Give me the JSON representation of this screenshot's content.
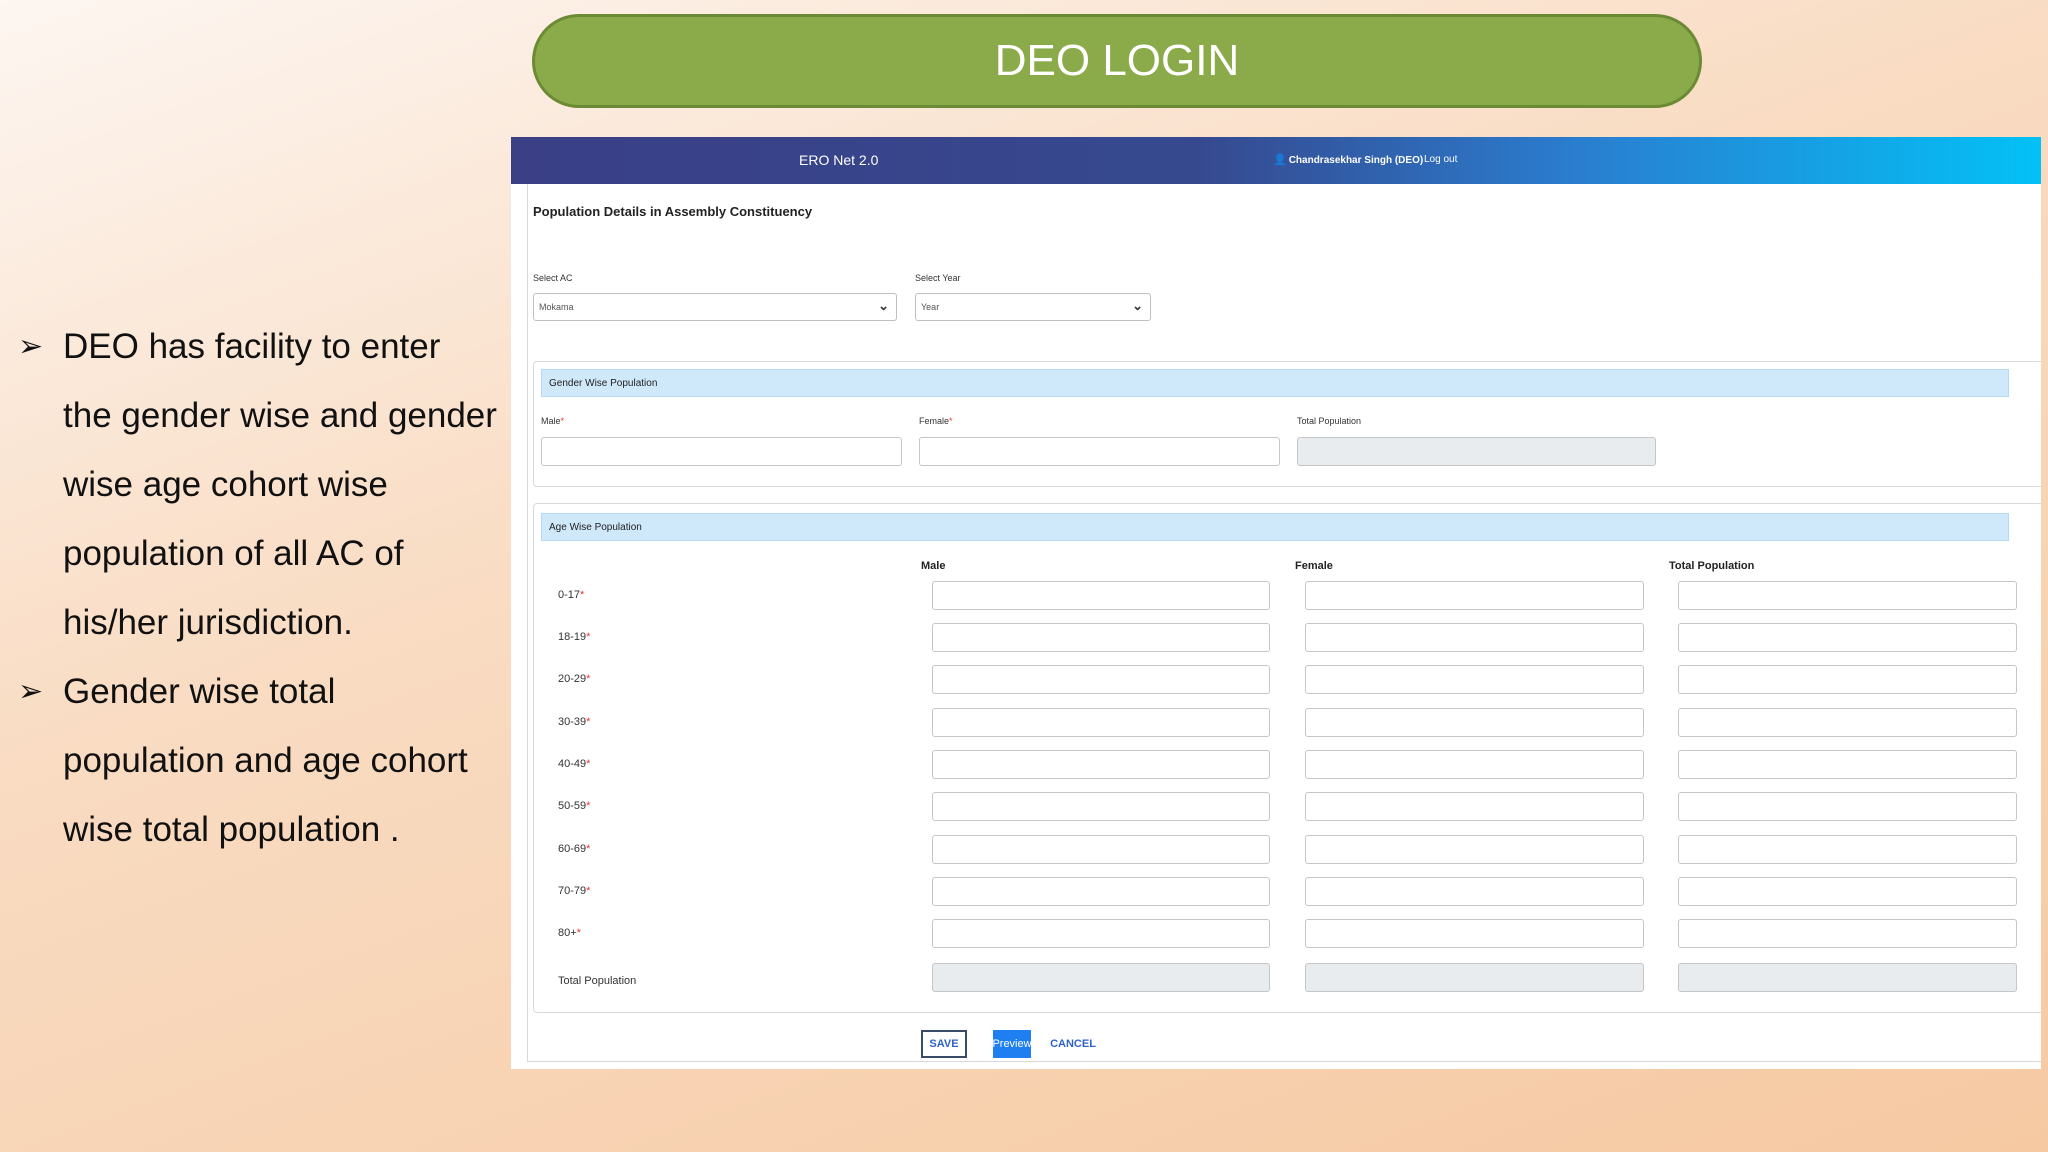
{
  "slide_title": "DEO LOGIN",
  "bullets": [
    {
      "text": "DEO has facility to enter the gender wise and gender wise age cohort wise population of all AC of his/her jurisdiction."
    },
    {
      "text": "Gender wise total population and age cohort wise total population ."
    }
  ],
  "app": {
    "name": "ERO Net 2.0",
    "user": "Chandrasekhar Singh (DEO)",
    "logout": "Log out"
  },
  "page_title": "Population Details in Assembly Constituency",
  "filters": {
    "ac_label": "Select AC",
    "ac_value": "Mokama",
    "year_label": "Select Year",
    "year_value": "Year"
  },
  "gender_section": {
    "title": "Gender Wise Population",
    "male_label": "Male",
    "female_label": "Female",
    "total_label": "Total Population"
  },
  "age_section": {
    "title": "Age Wise Population",
    "columns": [
      "Male",
      "Female",
      "Total Population"
    ],
    "rows": [
      "0-17",
      "18-19",
      "20-29",
      "30-39",
      "40-49",
      "50-59",
      "60-69",
      "70-79",
      "80+"
    ],
    "total_row_label": "Total Population"
  },
  "buttons": {
    "save": "SAVE",
    "preview": "Preview",
    "cancel": "CANCEL"
  }
}
